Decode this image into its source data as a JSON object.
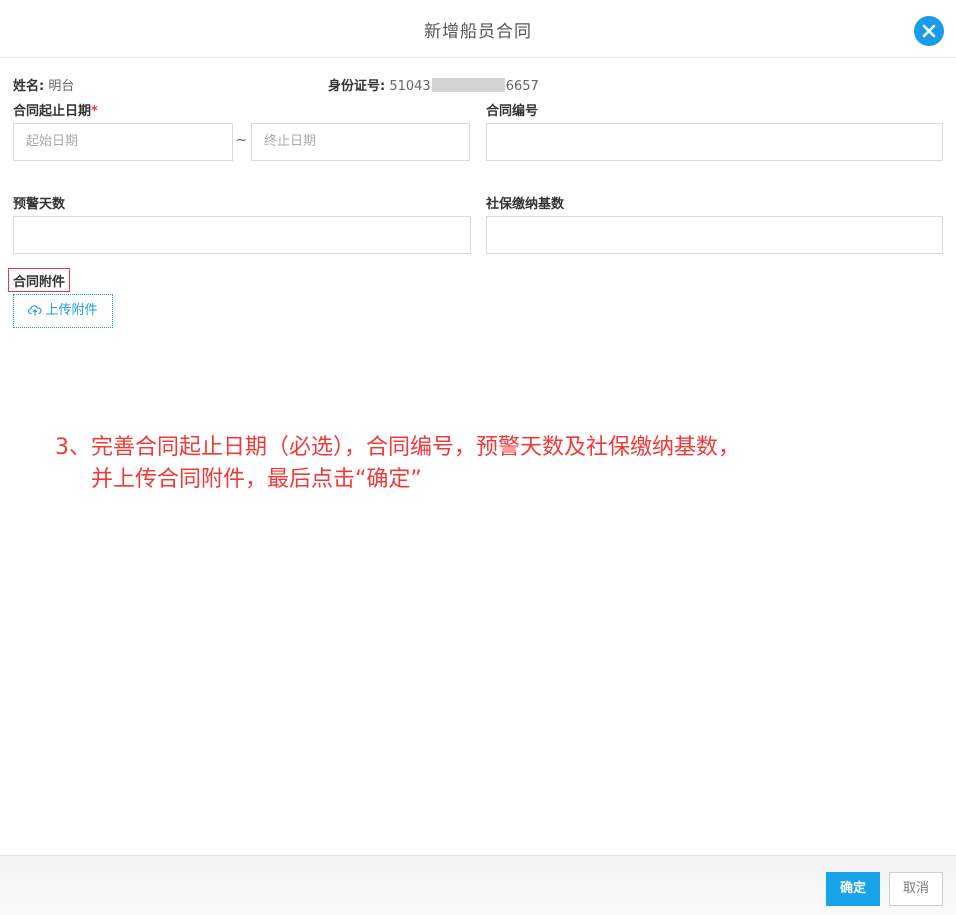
{
  "dialog": {
    "title": "新增船员合同",
    "close_icon": "close-icon"
  },
  "info": {
    "name_label": "姓名:",
    "name_value": "明台",
    "id_label": "身份证号:",
    "id_prefix": "51043",
    "id_suffix": "6657"
  },
  "form": {
    "date_range_label": "合同起止日期",
    "required_mark": "*",
    "start_placeholder": "起始日期",
    "separator": "~",
    "end_placeholder": "终止日期",
    "contract_no_label": "合同编号",
    "contract_no_value": "",
    "warning_days_label": "预警天数",
    "warning_days_value": "",
    "social_base_label": "社保缴纳基数",
    "social_base_value": "",
    "attachment_label": "合同附件",
    "upload_label": "上传附件",
    "upload_icon": "cloud-upload-icon"
  },
  "annotation": {
    "line1": "3、完善合同起止日期（必选），合同编号，预警天数及社保缴纳基数，",
    "line2": "并上传合同附件，最后点击“确定”"
  },
  "footer": {
    "confirm_label": "确定",
    "cancel_label": "取消"
  },
  "colors": {
    "accent": "#1a9be8",
    "annotation": "#f03a3a",
    "required": "#e23b3b"
  }
}
